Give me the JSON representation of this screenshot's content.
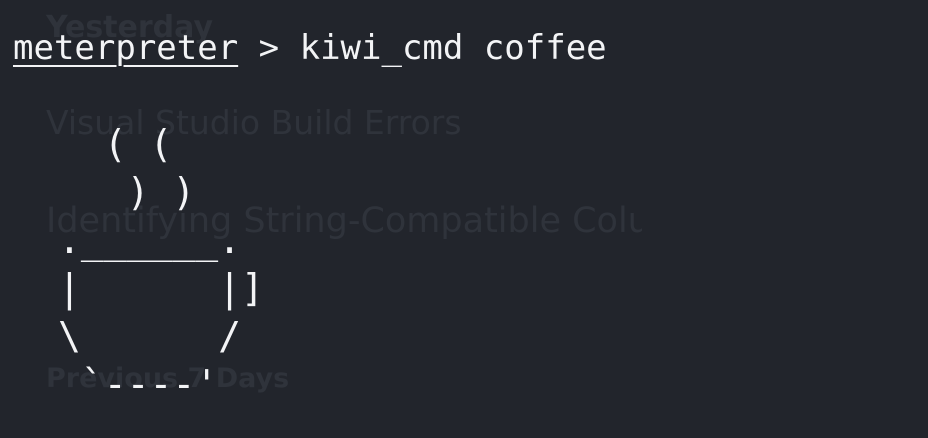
{
  "background_text": {
    "heading": "Yesterday",
    "items": [
      "Visual Studio Build Errors",
      "Identifying String-Compatible Colu"
    ],
    "section": "Previous 7 Days"
  },
  "terminal": {
    "prompt": "meterpreter",
    "separator": " > ",
    "command": "kiwi_cmd coffee",
    "output_art": "  ( (\n   ) )\n.______.\n|      |]\n\\      /\n `----'"
  },
  "colors": {
    "background": "#22252c",
    "foreground": "#f3f4f6",
    "ghost_text": "#2f333b"
  }
}
